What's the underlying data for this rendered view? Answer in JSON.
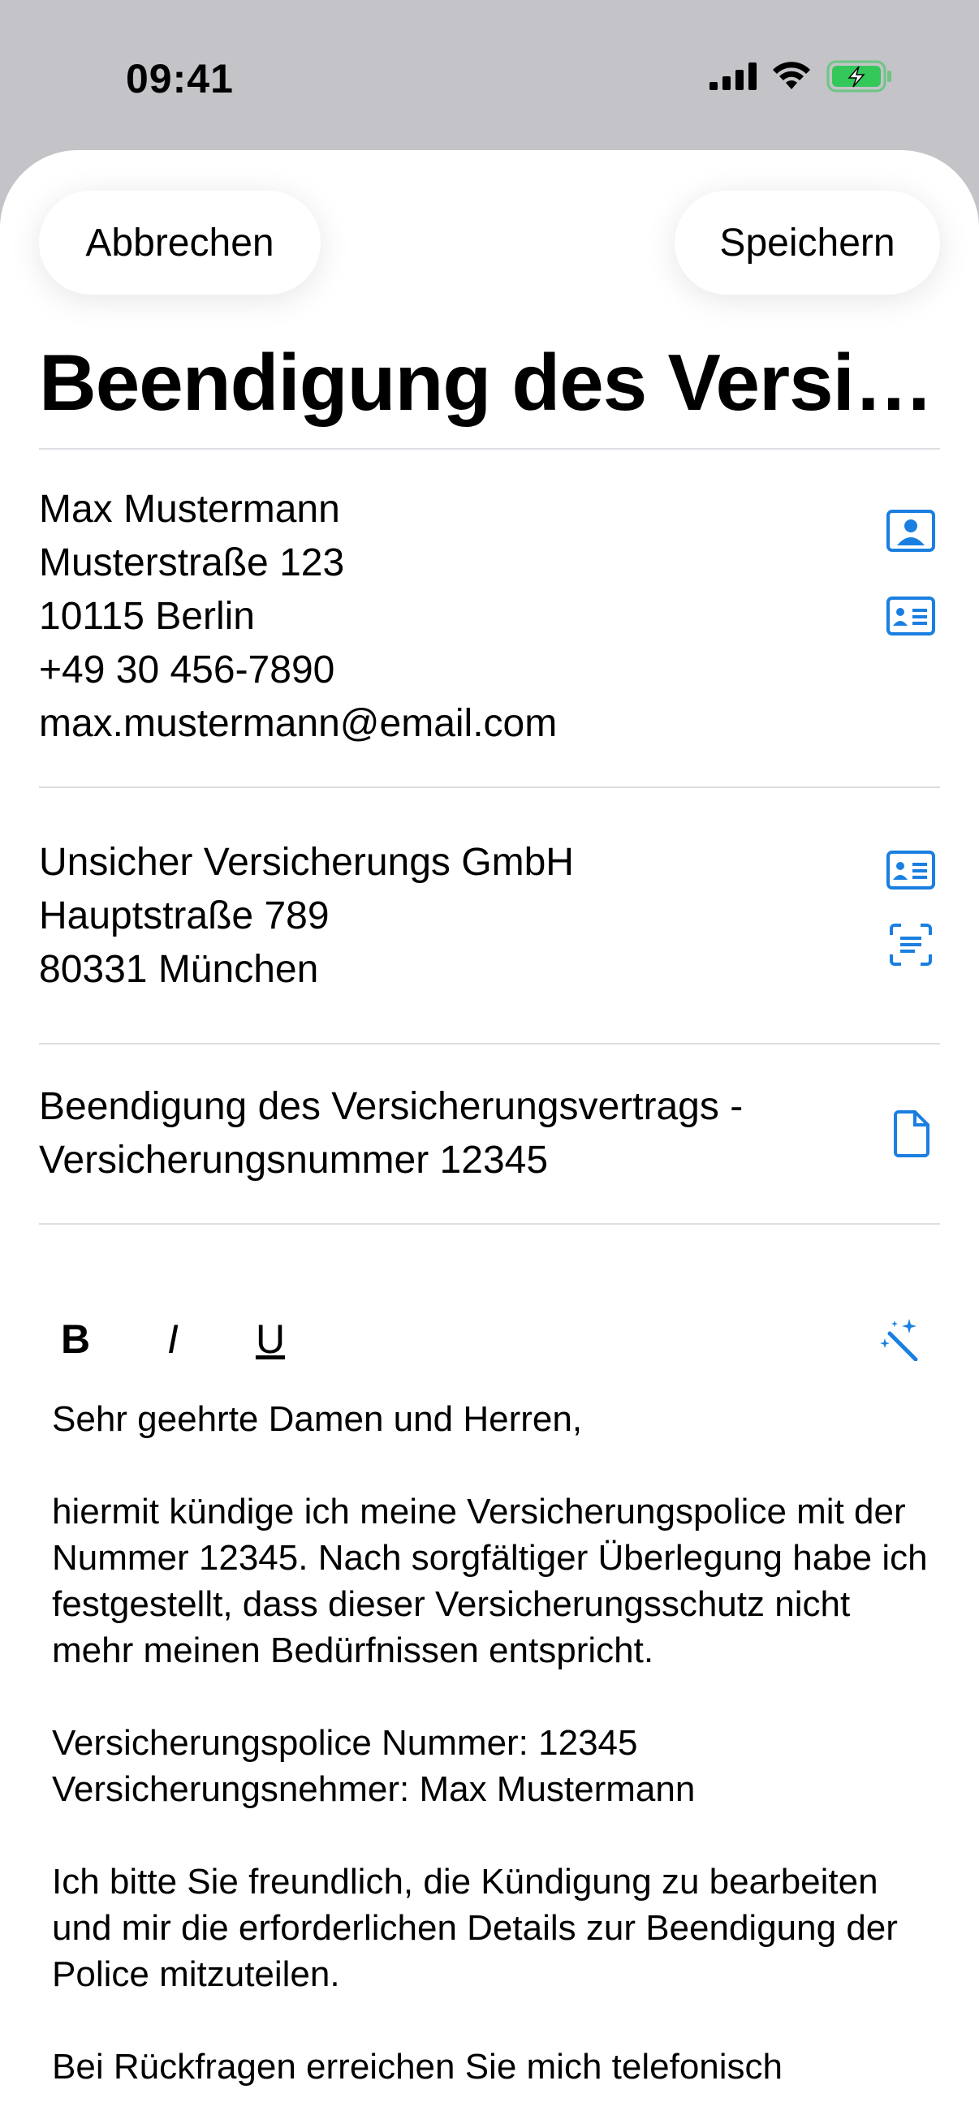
{
  "status": {
    "time": "09:41"
  },
  "header": {
    "cancel_label": "Abbrechen",
    "save_label": "Speichern",
    "title": "Beendigung des Versi…"
  },
  "sender": {
    "lines": [
      "Max Mustermann",
      "Musterstraße 123",
      "10115 Berlin",
      "+49 30 456-7890",
      "max.mustermann@email.com"
    ],
    "icons": [
      "contact-photo-icon",
      "contact-card-icon"
    ]
  },
  "recipient": {
    "lines": [
      "Unsicher Versicherungs GmbH",
      "Hauptstraße 789",
      "80331 München"
    ],
    "icons": [
      "contact-card-icon",
      "scan-text-icon"
    ]
  },
  "subject": {
    "lines": [
      "Beendigung des Versicherungsvertrags -",
      "Versicherungsnummer 12345"
    ],
    "icons": [
      "document-icon"
    ]
  },
  "format_toolbar": {
    "bold": "B",
    "italic": "I",
    "underline": "U",
    "magic_icon": "magic-wand-icon"
  },
  "letter": {
    "greeting": "Sehr geehrte Damen und Herren,",
    "p1": "hiermit kündige ich meine Versicherungspolice mit der Nummer 12345. Nach sorgfältiger Überlegung habe ich festgestellt, dass dieser Versicherungsschutz nicht mehr meinen Bedürfnissen entspricht.",
    "policy_line": "Versicherungspolice Nummer: 12345",
    "holder_line": "Versicherungsnehmer: Max Mustermann",
    "p2": "Ich bitte Sie freundlich, die Kündigung zu bearbeiten und mir die erforderlichen Details zur Beendigung der Police mitzuteilen.",
    "p3": "Bei Rückfragen erreichen Sie mich telefonisch"
  },
  "colors": {
    "accent": "#1a7fe0",
    "battery": "#34c759",
    "separator": "#dedee3"
  }
}
